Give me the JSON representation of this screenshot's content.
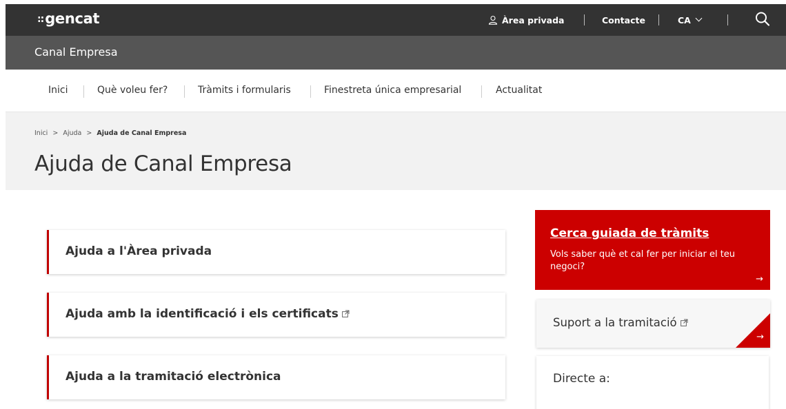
{
  "header": {
    "logo": "gencat",
    "logo_mark": "::",
    "private_area": "Àrea privada",
    "contact": "Contacte",
    "language": "CA"
  },
  "site": {
    "name": "Canal Empresa"
  },
  "nav": {
    "items": [
      {
        "label": "Inici"
      },
      {
        "label": "Què voleu fer?"
      },
      {
        "label": "Tràmits i formularis"
      },
      {
        "label": "Finestreta única empresarial"
      },
      {
        "label": "Actualitat"
      }
    ]
  },
  "breadcrumb": {
    "items": [
      "Inici",
      "Ajuda",
      "Ajuda de Canal Empresa"
    ],
    "separator": ">"
  },
  "page": {
    "title": "Ajuda de Canal Empresa"
  },
  "cards": [
    {
      "label": "Ajuda a l'Àrea privada",
      "external": false
    },
    {
      "label": "Ajuda amb la identificació i els certificats",
      "external": true
    },
    {
      "label": "Ajuda a la tramitació electrònica",
      "external": false
    }
  ],
  "promo": {
    "title": "Cerca guiada de tràmits",
    "description": "Vols saber què et cal fer per iniciar el teu negoci?",
    "arrow": "→"
  },
  "support": {
    "label": "Suport a la tramitació",
    "arrow": "→"
  },
  "direct": {
    "label": "Directe a:"
  },
  "colors": {
    "accent": "#cc0000",
    "topbar": "#333333",
    "sitebar": "#555555",
    "hero": "#f2f2f2"
  },
  "icons": [
    "user-icon",
    "chevron-down-icon",
    "search-icon",
    "external-link-icon",
    "arrow-right-icon"
  ]
}
